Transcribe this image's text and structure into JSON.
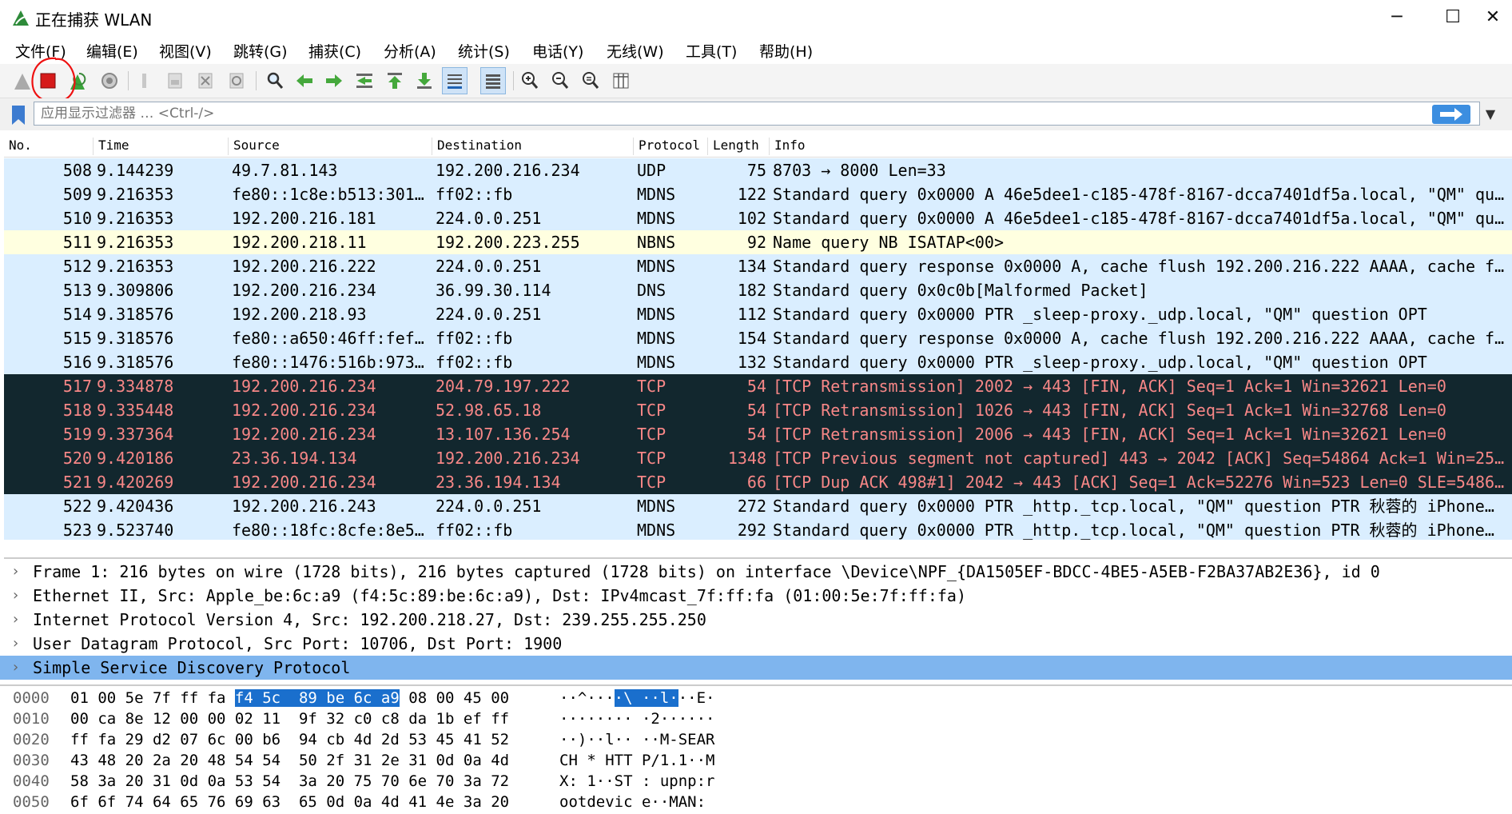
{
  "window": {
    "title": "正在捕获 WLAN",
    "minimize": "─",
    "maximize": "☐",
    "close": "✕"
  },
  "menu": [
    "文件(F)",
    "编辑(E)",
    "视图(V)",
    "跳转(G)",
    "捕获(C)",
    "分析(A)",
    "统计(S)",
    "电话(Y)",
    "无线(W)",
    "工具(T)",
    "帮助(H)"
  ],
  "filter": {
    "placeholder": "应用显示过滤器 … <Ctrl-/>"
  },
  "packet_list": {
    "columns": [
      "No.",
      "Time",
      "Source",
      "Destination",
      "Protocol",
      "Length",
      "Info"
    ],
    "rows": [
      {
        "no": "508",
        "time": "9.144239",
        "src": "49.7.81.143",
        "dst": "192.200.216.234",
        "proto": "UDP",
        "len": "75",
        "info": "8703 → 8000 Len=33",
        "style": "udp"
      },
      {
        "no": "509",
        "time": "9.216353",
        "src": "fe80::1c8e:b513:301…",
        "dst": "ff02::fb",
        "proto": "MDNS",
        "len": "122",
        "info": "Standard query 0x0000 A 46e5dee1-c185-478f-8167-dcca7401df5a.local, \"QM\" qu…",
        "style": "udp"
      },
      {
        "no": "510",
        "time": "9.216353",
        "src": "192.200.216.181",
        "dst": "224.0.0.251",
        "proto": "MDNS",
        "len": "102",
        "info": "Standard query 0x0000 A 46e5dee1-c185-478f-8167-dcca7401df5a.local, \"QM\" qu…",
        "style": "udp"
      },
      {
        "no": "511",
        "time": "9.216353",
        "src": "192.200.218.11",
        "dst": "192.200.223.255",
        "proto": "NBNS",
        "len": "92",
        "info": "Name query NB ISATAP<00>",
        "style": "nbns"
      },
      {
        "no": "512",
        "time": "9.216353",
        "src": "192.200.216.222",
        "dst": "224.0.0.251",
        "proto": "MDNS",
        "len": "134",
        "info": "Standard query response 0x0000 A, cache flush 192.200.216.222 AAAA, cache f…",
        "style": "udp"
      },
      {
        "no": "513",
        "time": "9.309806",
        "src": "192.200.216.234",
        "dst": "36.99.30.114",
        "proto": "DNS",
        "len": "182",
        "info": "Standard query 0x0c0b[Malformed Packet]",
        "style": "udp"
      },
      {
        "no": "514",
        "time": "9.318576",
        "src": "192.200.218.93",
        "dst": "224.0.0.251",
        "proto": "MDNS",
        "len": "112",
        "info": "Standard query 0x0000 PTR _sleep-proxy._udp.local, \"QM\" question OPT",
        "style": "udp"
      },
      {
        "no": "515",
        "time": "9.318576",
        "src": "fe80::a650:46ff:fef…",
        "dst": "ff02::fb",
        "proto": "MDNS",
        "len": "154",
        "info": "Standard query response 0x0000 A, cache flush 192.200.216.222 AAAA, cache f…",
        "style": "udp"
      },
      {
        "no": "516",
        "time": "9.318576",
        "src": "fe80::1476:516b:973…",
        "dst": "ff02::fb",
        "proto": "MDNS",
        "len": "132",
        "info": "Standard query 0x0000 PTR _sleep-proxy._udp.local, \"QM\" question OPT",
        "style": "udp"
      },
      {
        "no": "517",
        "time": "9.334878",
        "src": "192.200.216.234",
        "dst": "204.79.197.222",
        "proto": "TCP",
        "len": "54",
        "info": "[TCP Retransmission] 2002 → 443 [FIN, ACK] Seq=1 Ack=1 Win=32621 Len=0",
        "style": "bad-red"
      },
      {
        "no": "518",
        "time": "9.335448",
        "src": "192.200.216.234",
        "dst": "52.98.65.18",
        "proto": "TCP",
        "len": "54",
        "info": "[TCP Retransmission] 1026 → 443 [FIN, ACK] Seq=1 Ack=1 Win=32768 Len=0",
        "style": "bad-red"
      },
      {
        "no": "519",
        "time": "9.337364",
        "src": "192.200.216.234",
        "dst": "13.107.136.254",
        "proto": "TCP",
        "len": "54",
        "info": "[TCP Retransmission] 2006 → 443 [FIN, ACK] Seq=1 Ack=1 Win=32621 Len=0",
        "style": "bad-red"
      },
      {
        "no": "520",
        "time": "9.420186",
        "src": "23.36.194.134",
        "dst": "192.200.216.234",
        "proto": "TCP",
        "len": "1348",
        "info": "[TCP Previous segment not captured] 443 → 2042 [ACK] Seq=54864 Ack=1 Win=25…",
        "style": "bad-red"
      },
      {
        "no": "521",
        "time": "9.420269",
        "src": "192.200.216.234",
        "dst": "23.36.194.134",
        "proto": "TCP",
        "len": "66",
        "info": "[TCP Dup ACK 498#1] 2042 → 443 [ACK] Seq=1 Ack=52276 Win=523 Len=0 SLE=5486…",
        "style": "bad-red"
      },
      {
        "no": "522",
        "time": "9.420436",
        "src": "192.200.216.243",
        "dst": "224.0.0.251",
        "proto": "MDNS",
        "len": "272",
        "info": "Standard query 0x0000 PTR _http._tcp.local, \"QM\" question PTR 秋蓉的 iPhone…",
        "style": "udp"
      },
      {
        "no": "523",
        "time": "9.523740",
        "src": "fe80::18fc:8cfe:8e5…",
        "dst": "ff02::fb",
        "proto": "MDNS",
        "len": "292",
        "info": "Standard query 0x0000 PTR _http._tcp.local, \"QM\" question PTR 秋蓉的 iPhone…",
        "style": "udp"
      }
    ]
  },
  "details": [
    {
      "text": "Frame 1: 216 bytes on wire (1728 bits), 216 bytes captured (1728 bits) on interface \\Device\\NPF_{DA1505EF-BDCC-4BE5-A5EB-F2BA37AB2E36}, id 0",
      "selected": false
    },
    {
      "text": "Ethernet II, Src: Apple_be:6c:a9 (f4:5c:89:be:6c:a9), Dst: IPv4mcast_7f:ff:fa (01:00:5e:7f:ff:fa)",
      "selected": false
    },
    {
      "text": "Internet Protocol Version 4, Src: 192.200.218.27, Dst: 239.255.255.250",
      "selected": false
    },
    {
      "text": "User Datagram Protocol, Src Port: 10706, Dst Port: 1900",
      "selected": false
    },
    {
      "text": "Simple Service Discovery Protocol",
      "selected": true
    }
  ],
  "hex": [
    {
      "offset": "0000",
      "pre": "01 00 5e 7f ff fa ",
      "hl": "f4 5c  89 be 6c a9",
      "post": " 08 00 45 00",
      "apre": "··^···",
      "ahl": "·\\ ··l·",
      "apost": "··E·"
    },
    {
      "offset": "0010",
      "pre": "00 ca 8e 12 00 00 02 11  9f 32 c0 c8 da 1b ef ff",
      "hl": "",
      "post": "",
      "apre": "········ ·2······",
      "ahl": "",
      "apost": ""
    },
    {
      "offset": "0020",
      "pre": "ff fa 29 d2 07 6c 00 b6  94 cb 4d 2d 53 45 41 52",
      "hl": "",
      "post": "",
      "apre": "··)··l·· ··M-SEAR",
      "ahl": "",
      "apost": ""
    },
    {
      "offset": "0030",
      "pre": "43 48 20 2a 20 48 54 54  50 2f 31 2e 31 0d 0a 4d",
      "hl": "",
      "post": "",
      "apre": "CH * HTT P/1.1··M",
      "ahl": "",
      "apost": ""
    },
    {
      "offset": "0040",
      "pre": "58 3a 20 31 0d 0a 53 54  3a 20 75 70 6e 70 3a 72",
      "hl": "",
      "post": "",
      "apre": "X: 1··ST : upnp:r",
      "ahl": "",
      "apost": ""
    },
    {
      "offset": "0050",
      "pre": "6f 6f 74 64 65 76 69 63  65 0d 0a 4d 41 4e 3a 20",
      "hl": "",
      "post": "",
      "apre": "ootdevic e··MAN: ",
      "ahl": "",
      "apost": ""
    }
  ],
  "colors": {
    "udp_bg": "#daeeff",
    "nbns_bg": "#ffffe0",
    "bad_bg": "#12272e",
    "bad_fg": "#f78787",
    "selected_detail": "#7fb5ee",
    "accent": "#3c8ee0"
  }
}
